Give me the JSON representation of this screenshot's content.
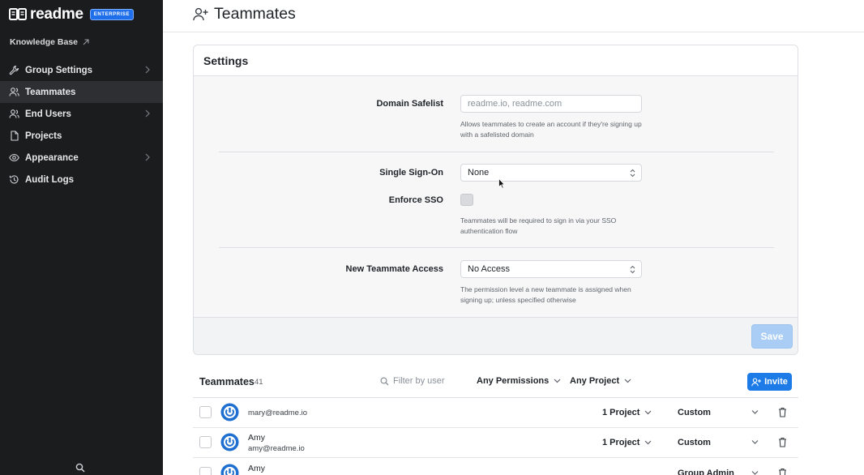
{
  "sidebar": {
    "logo_text": "readme",
    "badge": "ENTERPRISE",
    "knowledge_base": "Knowledge Base",
    "items": [
      {
        "label": "Group Settings",
        "icon": "wrench-icon",
        "has_chevron": true,
        "active": false
      },
      {
        "label": "Teammates",
        "icon": "users-icon",
        "has_chevron": false,
        "active": true
      },
      {
        "label": "End Users",
        "icon": "users-icon",
        "has_chevron": true,
        "active": false
      },
      {
        "label": "Projects",
        "icon": "file-icon",
        "has_chevron": false,
        "active": false
      },
      {
        "label": "Appearance",
        "icon": "eye-icon",
        "has_chevron": true,
        "active": false
      },
      {
        "label": "Audit Logs",
        "icon": "history-icon",
        "has_chevron": false,
        "active": false
      }
    ],
    "search_icon": "search-icon"
  },
  "header": {
    "title": "Teammates",
    "icon": "user-plus-icon"
  },
  "settings": {
    "title": "Settings",
    "domain_safelist": {
      "label": "Domain Safelist",
      "value": "",
      "placeholder": "readme.io, readme.com",
      "help": "Allows teammates to create an account if they're signing up with a safelisted domain"
    },
    "sso": {
      "label": "Single Sign-On",
      "value": "None"
    },
    "enforce_sso": {
      "label": "Enforce SSO",
      "checked": false,
      "help": "Teammates will be required to sign in via your SSO authentication flow"
    },
    "new_access": {
      "label": "New Teammate Access",
      "value": "No Access",
      "help": "The permission level a new teammate is assigned when signing up; unless specified otherwise"
    },
    "save_label": "Save"
  },
  "teammates": {
    "title": "Teammates",
    "count": "41",
    "filter_placeholder": "Filter by user",
    "permissions_filter": "Any Permissions",
    "project_filter": "Any Project",
    "invite_label": "Invite",
    "rows": [
      {
        "name": "",
        "email": "mary@readme.io",
        "projects": "1 Project",
        "role": "Custom"
      },
      {
        "name": "Amy",
        "email": "amy@readme.io",
        "projects": "1 Project",
        "role": "Custom"
      },
      {
        "name": "Amy",
        "email": "",
        "projects": "",
        "role": "Group Admin"
      }
    ]
  },
  "colors": {
    "sidebar_bg": "#1b1c1e",
    "accent": "#1c7be6",
    "save_disabled": "#a9cdf4",
    "avatar_blue": "#1e6fd0"
  }
}
